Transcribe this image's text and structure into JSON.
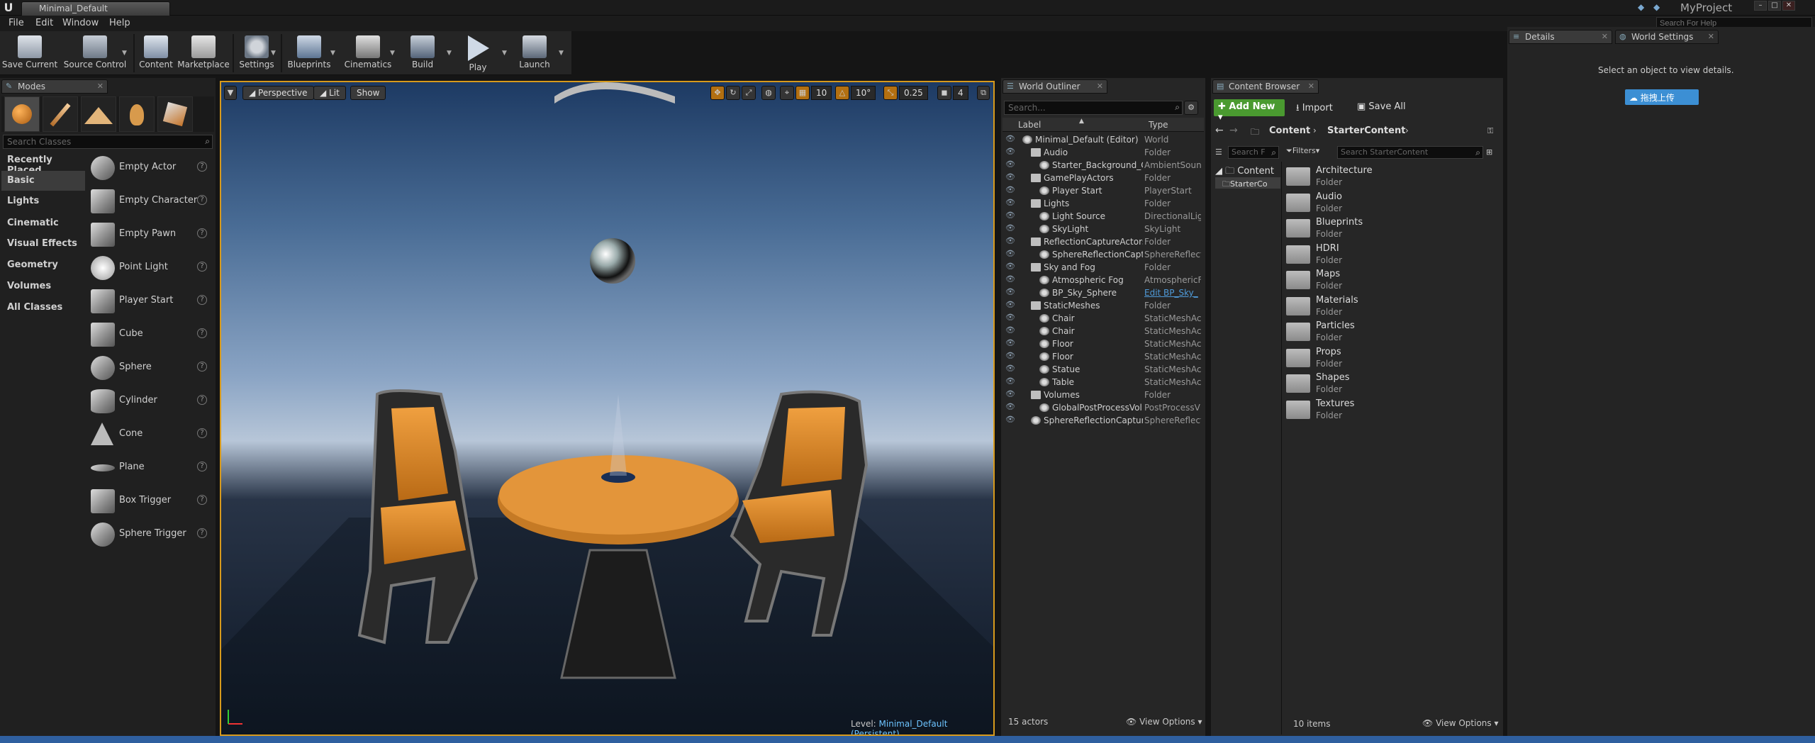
{
  "window": {
    "tab_title": "Minimal_Default",
    "project_name": "MyProject",
    "help_search_placeholder": "Search For Help"
  },
  "menu": [
    "File",
    "Edit",
    "Window",
    "Help"
  ],
  "toolbar": {
    "buttons": [
      {
        "label": "Save Current",
        "icon": "save-icon"
      },
      {
        "label": "Source Control",
        "icon": "source-control-icon"
      },
      {
        "label": "Content",
        "icon": "content-icon"
      },
      {
        "label": "Marketplace",
        "icon": "marketplace-icon"
      },
      {
        "label": "Settings",
        "icon": "settings-icon"
      },
      {
        "label": "Blueprints",
        "icon": "blueprints-icon"
      },
      {
        "label": "Cinematics",
        "icon": "cinematics-icon"
      },
      {
        "label": "Build",
        "icon": "build-icon"
      },
      {
        "label": "Play",
        "icon": "play-icon"
      },
      {
        "label": "Launch",
        "icon": "launch-icon"
      }
    ]
  },
  "modes": {
    "tab_label": "Modes",
    "search_placeholder": "Search Classes",
    "categories": [
      "Recently Placed",
      "Basic",
      "Lights",
      "Cinematic",
      "Visual Effects",
      "Geometry",
      "Volumes",
      "All Classes"
    ],
    "active_category": "Basic",
    "items": [
      "Empty Actor",
      "Empty Character",
      "Empty Pawn",
      "Point Light",
      "Player Start",
      "Cube",
      "Sphere",
      "Cylinder",
      "Cone",
      "Plane",
      "Box Trigger",
      "Sphere Trigger"
    ],
    "help_glyph": "?"
  },
  "viewport": {
    "perspective_label": "Perspective",
    "lit_label": "Lit",
    "show_label": "Show",
    "grid_snap": "10",
    "rotation_snap": "10°",
    "scale_snap": "0.25",
    "camera_speed": "4",
    "level_label": "Level:",
    "level_name": "Minimal_Default (Persistent)"
  },
  "outliner": {
    "tab_label": "World Outliner",
    "search_placeholder": "Search...",
    "col_label": "Label",
    "col_type": "Type",
    "rows": [
      {
        "label": "Minimal_Default (Editor)",
        "type": "World",
        "indent": 0
      },
      {
        "label": "Audio",
        "type": "Folder",
        "indent": 1
      },
      {
        "label": "Starter_Background_C",
        "type": "AmbientSound",
        "indent": 2
      },
      {
        "label": "GamePlayActors",
        "type": "Folder",
        "indent": 1
      },
      {
        "label": "Player Start",
        "type": "PlayerStart",
        "indent": 2
      },
      {
        "label": "Lights",
        "type": "Folder",
        "indent": 1
      },
      {
        "label": "Light Source",
        "type": "DirectionalLig",
        "indent": 2
      },
      {
        "label": "SkyLight",
        "type": "SkyLight",
        "indent": 2
      },
      {
        "label": "ReflectionCaptureActors",
        "type": "Folder",
        "indent": 1
      },
      {
        "label": "SphereReflectionCapt",
        "type": "SphereReflect",
        "indent": 2
      },
      {
        "label": "Sky and Fog",
        "type": "Folder",
        "indent": 1
      },
      {
        "label": "Atmospheric Fog",
        "type": "AtmosphericF",
        "indent": 2
      },
      {
        "label": "BP_Sky_Sphere",
        "type": "Edit BP_Sky_",
        "indent": 2
      },
      {
        "label": "StaticMeshes",
        "type": "Folder",
        "indent": 1
      },
      {
        "label": "Chair",
        "type": "StaticMeshAc",
        "indent": 2
      },
      {
        "label": "Chair",
        "type": "StaticMeshAc",
        "indent": 2
      },
      {
        "label": "Floor",
        "type": "StaticMeshAc",
        "indent": 2
      },
      {
        "label": "Floor",
        "type": "StaticMeshAc",
        "indent": 2
      },
      {
        "label": "Statue",
        "type": "StaticMeshAc",
        "indent": 2
      },
      {
        "label": "Table",
        "type": "StaticMeshAc",
        "indent": 2
      },
      {
        "label": "Volumes",
        "type": "Folder",
        "indent": 1
      },
      {
        "label": "GlobalPostProcessVol",
        "type": "PostProcessV",
        "indent": 2
      },
      {
        "label": "SphereReflectionCapture",
        "type": "SphereReflect",
        "indent": 1
      }
    ],
    "actor_count": "15 actors",
    "view_options": "View Options"
  },
  "content_browser": {
    "tab_label": "Content Browser",
    "add_new": "Add New",
    "import": "Import",
    "save_all": "Save All",
    "path": [
      "Content",
      "StarterContent"
    ],
    "filters": "Filters",
    "search_placeholder": "Search StarterContent",
    "tree_search_placeholder": "Search F",
    "tree_root": "Content",
    "tree_child": "StarterCo",
    "folders": [
      "Architecture",
      "Audio",
      "Blueprints",
      "HDRI",
      "Maps",
      "Materials",
      "Particles",
      "Props",
      "Shapes",
      "Textures"
    ],
    "folder_type": "Folder",
    "item_count": "10 items",
    "view_options": "View Options"
  },
  "details": {
    "tab_label": "Details",
    "world_settings_tab": "World Settings",
    "empty_message": "Select an object to view details.",
    "upload_button": "拖拽上传"
  },
  "colors": {
    "accent_orange": "#d79a1c",
    "add_new_green": "#4a9a30",
    "link_blue": "#4f9ad8"
  }
}
